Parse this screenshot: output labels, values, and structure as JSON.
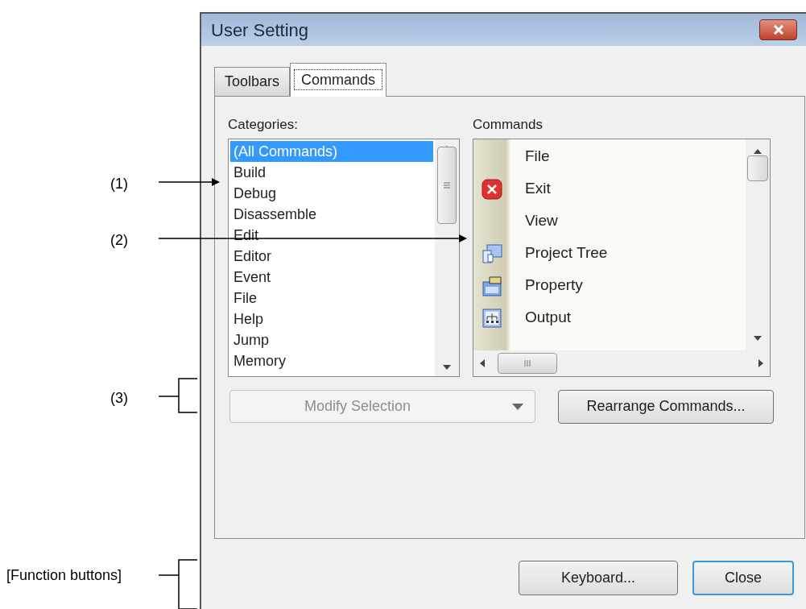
{
  "window": {
    "title": "User Setting"
  },
  "tabs": [
    {
      "label": "Toolbars",
      "selected": false
    },
    {
      "label": "Commands",
      "selected": true
    }
  ],
  "categories": {
    "label": "Categories:",
    "items": [
      {
        "label": "(All Commands)",
        "selected": true
      },
      {
        "label": "Build",
        "selected": false
      },
      {
        "label": "Debug",
        "selected": false
      },
      {
        "label": "Disassemble",
        "selected": false
      },
      {
        "label": "Edit",
        "selected": false
      },
      {
        "label": "Editor",
        "selected": false
      },
      {
        "label": "Event",
        "selected": false
      },
      {
        "label": "File",
        "selected": false
      },
      {
        "label": "Help",
        "selected": false
      },
      {
        "label": "Jump",
        "selected": false
      },
      {
        "label": "Memory",
        "selected": false
      }
    ]
  },
  "commands": {
    "label": "Commands",
    "items": [
      {
        "label": "File",
        "kind": "group"
      },
      {
        "label": "Exit",
        "kind": "command"
      },
      {
        "label": "View",
        "kind": "group"
      },
      {
        "label": "Project Tree",
        "kind": "command"
      },
      {
        "label": "Property",
        "kind": "command"
      },
      {
        "label": "Output",
        "kind": "command"
      }
    ]
  },
  "modify_selection": {
    "label": "Modify Selection",
    "disabled": true
  },
  "rearrange_button": "Rearrange Commands...",
  "buttons": [
    {
      "label": "Keyboard...",
      "default": false
    },
    {
      "label": "Close",
      "default": true
    }
  ],
  "annotations": [
    {
      "label": "(1)",
      "kind": "arrow"
    },
    {
      "label": "(2)",
      "kind": "arrow"
    },
    {
      "label": "(3)",
      "kind": "bracket"
    },
    {
      "label": "[Function buttons]",
      "kind": "bracket"
    }
  ]
}
